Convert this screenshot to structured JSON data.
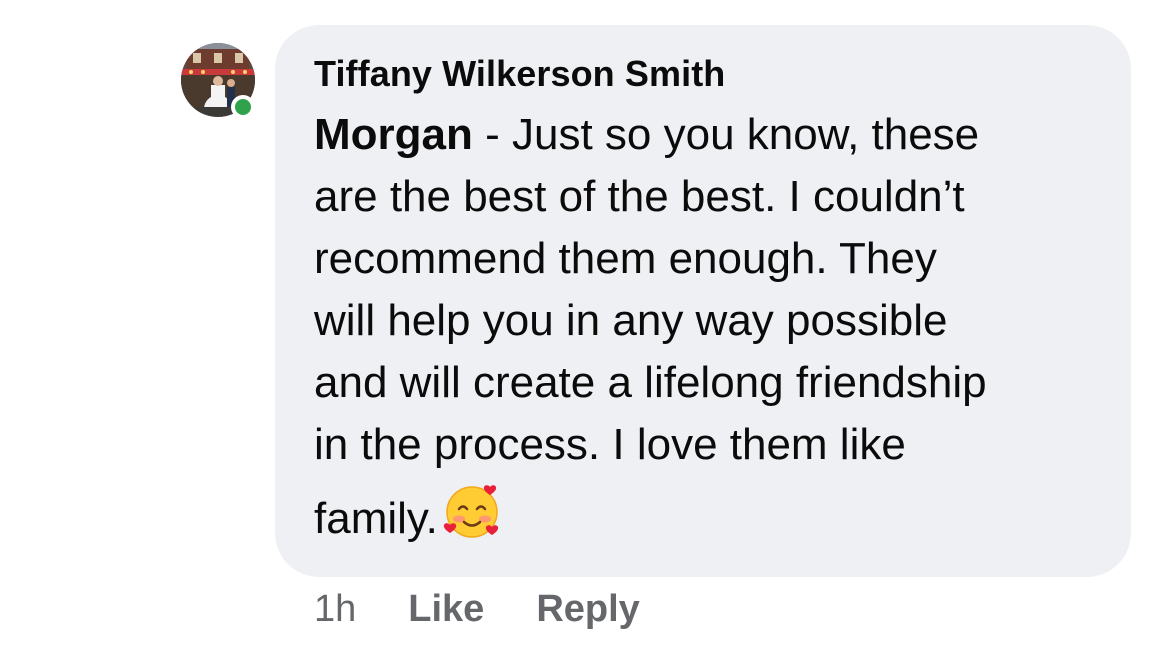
{
  "comment": {
    "author": "Tiffany Wilkerson Smith",
    "mention": "Morgan",
    "text_lines": [
      " - Just so you know, these",
      "are the best of the best. I couldn’t",
      "recommend them enough. They",
      "will help you in any way possible",
      "and will create a lifelong friendship",
      "in the process. I love them like",
      "family. "
    ],
    "emoji": "smiling-face-with-hearts",
    "timestamp": "1h",
    "like_label": "Like",
    "reply_label": "Reply",
    "online_status": "online"
  },
  "colors": {
    "bubble": "#eff0f4",
    "text": "#0b0b0b",
    "meta": "#65676b",
    "online": "#31a24c"
  }
}
